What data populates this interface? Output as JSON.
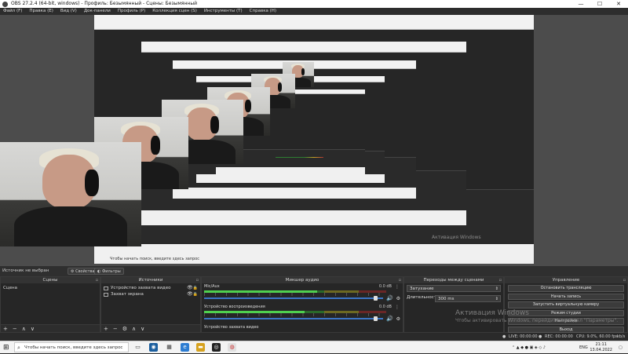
{
  "window": {
    "title": "OBS 27.2.4 (64-bit, windows) - Профиль: Безымянный - Сцены: Безымянный",
    "minimize_label": "—",
    "maximize_label": "☐",
    "close_label": "✕"
  },
  "menu": [
    "Файл (F)",
    "Правка (E)",
    "Вид (V)",
    "Док-панели",
    "Профиль (P)",
    "Коллекция сцен (S)",
    "Инструменты (T)",
    "Справка (H)"
  ],
  "preview": {
    "activation_title": "Активация Windows",
    "nested_taskbar_search": "Чтобы начать поиск, введите здесь запрос"
  },
  "infobar": {
    "no_source": "Источник не выбран",
    "properties": "Свойства",
    "filters": "Фильтры"
  },
  "scenes": {
    "title": "Сцены",
    "items": [
      "Сцена"
    ],
    "tools": [
      "+",
      "−",
      "∧",
      "∨"
    ]
  },
  "sources": {
    "title": "Источники",
    "items": [
      {
        "name": "Устройство захвата видео",
        "visible": "👁",
        "lock": "🔒"
      },
      {
        "name": "Захват экрана",
        "visible": "👁",
        "lock": "🔒"
      }
    ],
    "tools": [
      "+",
      "−",
      "⚙",
      "∧",
      "∨"
    ]
  },
  "mixer": {
    "title": "Микшер аудио",
    "channels": [
      {
        "name": "Mic/Aux",
        "db": "0.0 dB",
        "level": 0.62,
        "volume": 0.97
      },
      {
        "name": "Устройство воспроизведения",
        "db": "0.0 dB",
        "level": 0.55,
        "volume": 0.97
      },
      {
        "name": "Устройство захвата видео",
        "db": "",
        "level": 0.0,
        "volume": 0.97
      }
    ]
  },
  "transitions": {
    "title": "Переходы между сценами",
    "type": "Затухание",
    "duration_label": "Длительность",
    "duration_value": "300 ms"
  },
  "controls": {
    "title": "Управление",
    "buttons": [
      "Остановить трансляцию",
      "Начать запись",
      "Запустить виртуальную камеру",
      "Режим студии",
      "Настройки",
      "Выход"
    ]
  },
  "activation": {
    "title": "Активация Windows",
    "subtitle": "Чтобы активировать Windows, перейдите в раздел \"Параметры\"."
  },
  "status": {
    "live": "LIVE: 00:00:00",
    "rec": "REC: 00:00:00",
    "cpu": "CPU: 9.0%, 60.00 fps",
    "kbps": "kb/s"
  },
  "taskbar": {
    "search_placeholder": "Чтобы начать поиск, введите здесь запрос",
    "language": "ENG",
    "time": "21:11",
    "date": "13.04.2022"
  },
  "colors": {
    "accent_blue": "#3b74c4",
    "meter_green": "#4fd04f",
    "panel_bg": "#262626",
    "preview_bg": "#4c4c4c"
  }
}
